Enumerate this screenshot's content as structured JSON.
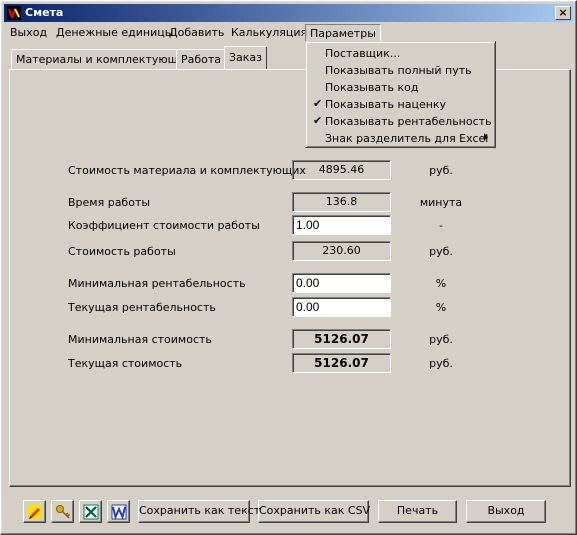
{
  "window": {
    "title": "Смета",
    "close_glyph": "×"
  },
  "menubar": {
    "items": [
      "Выход",
      "Денежные единицы",
      "Добавить",
      "Калькуляция",
      "Параметры"
    ]
  },
  "tabs": [
    "Материалы и комплектующие",
    "Работа",
    "Заказ"
  ],
  "active_tab": "Заказ",
  "params_menu": {
    "items": [
      {
        "label": "Поставщик...",
        "checked": false,
        "submenu": false
      },
      {
        "label": "Показывать полный путь",
        "checked": false,
        "submenu": false
      },
      {
        "label": "Показывать код",
        "checked": false,
        "submenu": false
      },
      {
        "label": "Показывать наценку",
        "checked": true,
        "submenu": false
      },
      {
        "label": "Показывать рентабельность",
        "checked": true,
        "submenu": false
      },
      {
        "label": "Знак разделитель для Excel",
        "checked": false,
        "submenu": true
      }
    ],
    "check_glyph": "✔"
  },
  "order": {
    "rows": [
      {
        "label": "Стоимость материала и комплектующих",
        "value": "4895.46",
        "editable": false,
        "unit": "руб."
      },
      {
        "label": "Время работы",
        "value": "136.8",
        "editable": false,
        "unit": "минута"
      },
      {
        "label": "Коэффициент стоимости работы",
        "value": "1.00",
        "editable": true,
        "unit": "-"
      },
      {
        "label": "Стоимость работы",
        "value": "230.60",
        "editable": false,
        "unit": "руб."
      },
      {
        "label": "Минимальная рентабельность",
        "value": "0.00",
        "editable": true,
        "unit": "%"
      },
      {
        "label": "Текущая рентабельность",
        "value": "0.00",
        "editable": true,
        "unit": "%"
      },
      {
        "label": "Минимальная стоимость",
        "value": "5126.07",
        "editable": false,
        "unit": "руб."
      },
      {
        "label": "Текущая стоимость",
        "value": "5126.07",
        "editable": false,
        "unit": "руб."
      }
    ]
  },
  "toolbar": {
    "icons": [
      "pencil-icon",
      "key-icon",
      "excel-icon",
      "word-icon"
    ],
    "save_text_label": "Сохранить как текст",
    "save_csv_label": "Сохранить как CSV",
    "print_label": "Печать",
    "exit_label": "Выход"
  },
  "colors": {
    "face": "#d4d0c8",
    "title_start": "#0a246a",
    "title_end": "#a6caf0"
  }
}
